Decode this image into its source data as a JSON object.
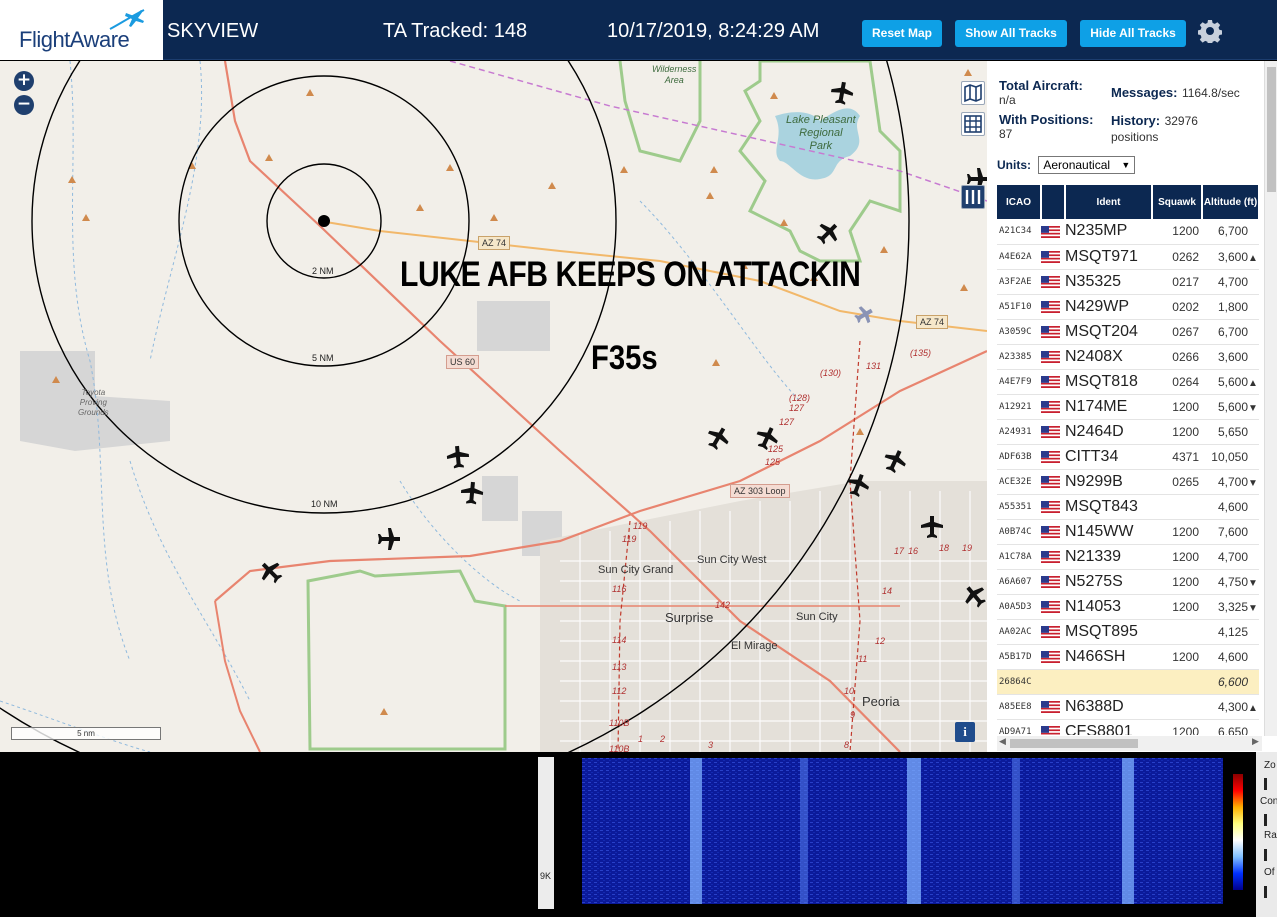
{
  "header": {
    "logo_text": "FlightAware",
    "app_name": "SKYVIEW",
    "ta_tracked": "TA Tracked: 148",
    "datetime": "10/17/2019, 8:24:29 AM",
    "btn_reset": "Reset Map",
    "btn_show": "Show All Tracks",
    "btn_hide": "Hide All Tracks"
  },
  "map": {
    "zoom_in": "+",
    "zoom_out": "−",
    "overlay_title": "LUKE AFB KEEPS ON ATTACKIN",
    "overlay_sub": "F35s",
    "scale_label": "5 nm",
    "info_label": "i",
    "ring_labels": [
      "2 NM",
      "5 NM",
      "10 NM"
    ],
    "places": {
      "lake": "Lake Pleasant\nRegional\nPark",
      "wilderness": "Wilderness\nArea",
      "toyota": "Toyota\nProving\nGrounds",
      "sun_city_grand": "Sun City Grand",
      "sun_city_west": "Sun City West",
      "surprise": "Surprise",
      "sun_city": "Sun City",
      "el_mirage": "El Mirage",
      "peoria": "Peoria"
    },
    "signs": {
      "az74a": "AZ 74",
      "az74b": "AZ 74",
      "us60": "US 60",
      "az303": "AZ 303 Loop"
    },
    "route_nums": [
      "(130)",
      "(135)",
      "131",
      "(128)",
      "127",
      "127",
      "125",
      "125",
      "119",
      "119",
      "116",
      "114",
      "113",
      "112",
      "110B",
      "110B",
      "142",
      "17",
      "16",
      "18",
      "19",
      "14",
      "12",
      "11",
      "10",
      "9",
      "8",
      "1",
      "2",
      "3"
    ]
  },
  "stats": {
    "total_label": "Total Aircraft:",
    "total_value": "n/a",
    "messages_label": "Messages:",
    "messages_value": "1164.8/sec",
    "positions_label": "With Positions:",
    "positions_value": "87",
    "history_label": "History:",
    "history_value": "32976",
    "history_unit": "positions",
    "units_label": "Units:",
    "units_value": "Aeronautical"
  },
  "table": {
    "headers": [
      "ICAO",
      "",
      "Ident",
      "Squawk",
      "Altitude (ft)"
    ],
    "rows": [
      {
        "icao": "A21C34",
        "ident": "N235MP",
        "squawk": "1200",
        "alt": "6,700",
        "trend": ""
      },
      {
        "icao": "A4E62A",
        "ident": "MSQT971",
        "squawk": "0262",
        "alt": "3,600",
        "trend": "▲"
      },
      {
        "icao": "A3F2AE",
        "ident": "N35325",
        "squawk": "0217",
        "alt": "4,700",
        "trend": ""
      },
      {
        "icao": "A51F10",
        "ident": "N429WP",
        "squawk": "0202",
        "alt": "1,800",
        "trend": ""
      },
      {
        "icao": "A3059C",
        "ident": "MSQT204",
        "squawk": "0267",
        "alt": "6,700",
        "trend": ""
      },
      {
        "icao": "A23385",
        "ident": "N2408X",
        "squawk": "0266",
        "alt": "3,600",
        "trend": ""
      },
      {
        "icao": "A4E7F9",
        "ident": "MSQT818",
        "squawk": "0264",
        "alt": "5,600",
        "trend": "▲"
      },
      {
        "icao": "A12921",
        "ident": "N174ME",
        "squawk": "1200",
        "alt": "5,600",
        "trend": "▼"
      },
      {
        "icao": "A24931",
        "ident": "N2464D",
        "squawk": "1200",
        "alt": "5,650",
        "trend": ""
      },
      {
        "icao": "ADF63B",
        "ident": "CITT34",
        "squawk": "4371",
        "alt": "10,050",
        "trend": ""
      },
      {
        "icao": "ACE32E",
        "ident": "N9299B",
        "squawk": "0265",
        "alt": "4,700",
        "trend": "▼"
      },
      {
        "icao": "A55351",
        "ident": "MSQT843",
        "squawk": "",
        "alt": "4,600",
        "trend": ""
      },
      {
        "icao": "A0B74C",
        "ident": "N145WW",
        "squawk": "1200",
        "alt": "7,600",
        "trend": ""
      },
      {
        "icao": "A1C78A",
        "ident": "N21339",
        "squawk": "1200",
        "alt": "4,700",
        "trend": ""
      },
      {
        "icao": "A6A607",
        "ident": "N5275S",
        "squawk": "1200",
        "alt": "4,750",
        "trend": "▼"
      },
      {
        "icao": "A0A5D3",
        "ident": "N14053",
        "squawk": "1200",
        "alt": "3,325",
        "trend": "▼"
      },
      {
        "icao": "AA02AC",
        "ident": "MSQT895",
        "squawk": "",
        "alt": "4,125",
        "trend": ""
      },
      {
        "icao": "A5B17D",
        "ident": "N466SH",
        "squawk": "1200",
        "alt": "4,600",
        "trend": ""
      },
      {
        "icao": "26864C",
        "ident": "",
        "squawk": "",
        "alt": "6,600",
        "trend": "",
        "highlight": true,
        "noflag": true
      },
      {
        "icao": "A85EE8",
        "ident": "N6388D",
        "squawk": "",
        "alt": "4,300",
        "trend": "▲"
      },
      {
        "icao": "AD9A71",
        "ident": "CFS8801",
        "squawk": "1200",
        "alt": "6,650",
        "trend": ""
      }
    ]
  },
  "bottom": {
    "left_frag_1": "9K",
    "ctl_zoom": "Zo",
    "ctl_con": "Con",
    "ctl_ra": "Ra",
    "ctl_of": "Of"
  },
  "colors": {
    "header_bg": "#0c2851",
    "button_blue": "#0ea0e6",
    "map_bg": "#f2efe9",
    "road_red": "#e8846f",
    "road_orange": "#f2b86a",
    "park_green": "#9ecb8c",
    "lake_blue": "#aad3df"
  }
}
